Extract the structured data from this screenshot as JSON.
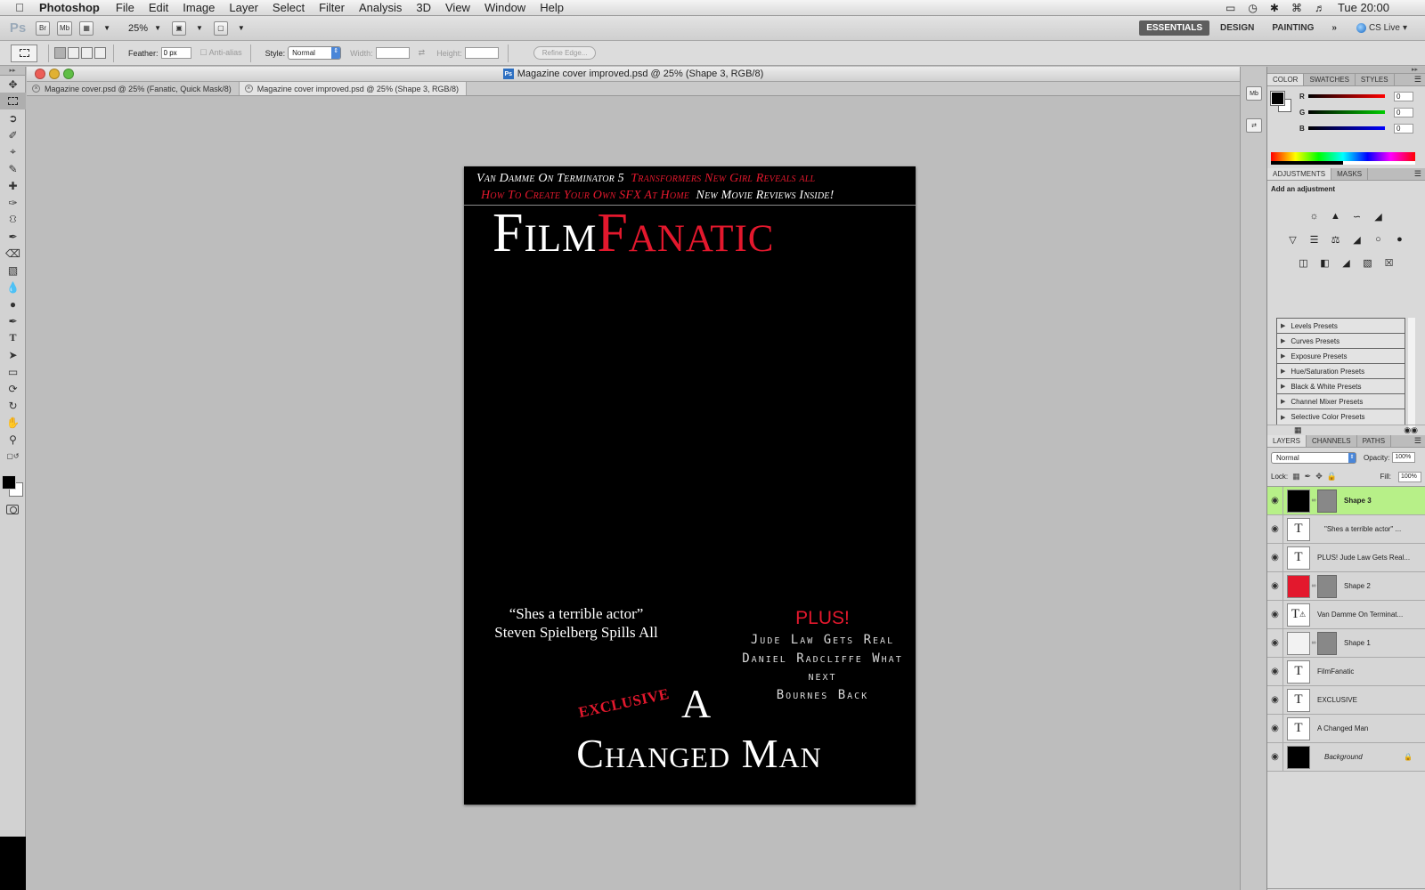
{
  "menubar": {
    "app_name": "Photoshop",
    "menus": [
      "File",
      "Edit",
      "Image",
      "Layer",
      "Select",
      "Filter",
      "Analysis",
      "3D",
      "View",
      "Window",
      "Help"
    ],
    "clock": "Tue 20:00"
  },
  "appbar": {
    "logo": "Ps",
    "bridge": "Br",
    "minibridge": "Mb",
    "zoom": "25%",
    "workspaces": [
      "ESSENTIALS",
      "DESIGN",
      "PAINTING"
    ],
    "more": "»",
    "cslive": "CS Live"
  },
  "options": {
    "feather_label": "Feather:",
    "feather_value": "0 px",
    "antialias_label": "Anti-alias",
    "style_label": "Style:",
    "style_value": "Normal",
    "width_label": "Width:",
    "height_label": "Height:",
    "refine_edge": "Refine Edge..."
  },
  "document": {
    "title": "Magazine cover improved.psd @ 25% (Shape 3, RGB/8)",
    "tabs": [
      "Magazine cover.psd @ 25% (Fanatic, Quick Mask/8)",
      "Magazine cover improved.psd @ 25% (Shape 3, RGB/8)"
    ]
  },
  "cover": {
    "strap1_white": "Van Damme On Terminator 5",
    "strap1_red": "Transformers New Girl Reveals all",
    "strap2_red": "How To Create Your Own SFX At Home",
    "strap2_white": "New Movie Reviews Inside!",
    "masthead_white": "Film",
    "masthead_red": "Fanatic",
    "quote_line1": "“Shes a terrible actor”",
    "quote_line2": "Steven Spielberg Spills All",
    "plus_title": "PLUS!",
    "plus_lines": [
      "Jude Law Gets Real",
      "Daniel Radcliffe What",
      "next",
      "Bournes Back"
    ],
    "exclusive": "EXCLUSIVE",
    "big_a": "A",
    "headline": "Changed Man"
  },
  "color_panel": {
    "tabs": [
      "COLOR",
      "SWATCHES",
      "STYLES"
    ],
    "r": "0",
    "g": "0",
    "b": "0",
    "r_label": "R",
    "g_label": "G",
    "b_label": "B"
  },
  "adjustments_panel": {
    "tabs": [
      "ADJUSTMENTS",
      "MASKS"
    ],
    "hint": "Add an adjustment",
    "presets": [
      "Levels Presets",
      "Curves Presets",
      "Exposure Presets",
      "Hue/Saturation Presets",
      "Black & White Presets",
      "Channel Mixer Presets",
      "Selective Color Presets"
    ]
  },
  "layers_panel": {
    "tabs": [
      "LAYERS",
      "CHANNELS",
      "PATHS"
    ],
    "blend_mode": "Normal",
    "opacity_label": "Opacity:",
    "opacity": "100%",
    "lock_label": "Lock:",
    "fill_label": "Fill:",
    "fill": "100%",
    "layers": [
      {
        "name": "Shape 3"
      },
      {
        "name": "\"Shes a terrible actor\"  ..."
      },
      {
        "name": "PLUS! Jude Law Gets Real..."
      },
      {
        "name": "Shape 2"
      },
      {
        "name": "Van Damme On Terminat..."
      },
      {
        "name": "Shape 1"
      },
      {
        "name": "FilmFanatic"
      },
      {
        "name": "EXCLUSIVE"
      },
      {
        "name": "A  Changed Man"
      },
      {
        "name": "Background"
      }
    ]
  },
  "colors": {
    "accent_red": "#e3182d",
    "selected_layer": "#b7f088",
    "active_workspace": "#5e5e5e"
  }
}
